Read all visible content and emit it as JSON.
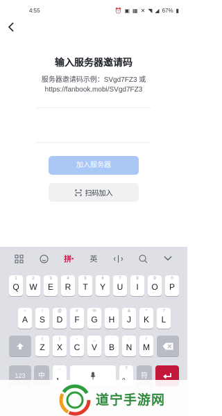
{
  "status": {
    "time": "4:55",
    "battery": "67%"
  },
  "page": {
    "title": "输入服务器邀请码",
    "hint_line1": "服务器邀请码示例：SVgd7FZ3 或",
    "hint_line2": "https://fanbook.mobi/SVgd7FZ3",
    "input_value": "",
    "join_button": "加入服务器",
    "scan_button": "扫码加入"
  },
  "keyboard": {
    "toolbar": [
      "grid-icon",
      "emoji-icon",
      "拼",
      "英",
      "cursor-icon",
      "search-icon",
      "collapse-icon"
    ],
    "row1": [
      {
        "main": "Q",
        "sub": "1"
      },
      {
        "main": "W",
        "sub": "2"
      },
      {
        "main": "E",
        "sub": "3"
      },
      {
        "main": "R",
        "sub": "4"
      },
      {
        "main": "T",
        "sub": "5"
      },
      {
        "main": "Y",
        "sub": "6"
      },
      {
        "main": "U",
        "sub": "7"
      },
      {
        "main": "I",
        "sub": "8"
      },
      {
        "main": "O",
        "sub": "9"
      },
      {
        "main": "P",
        "sub": "0"
      }
    ],
    "row2": [
      {
        "main": "A",
        "sub": "~"
      },
      {
        "main": "S",
        "sub": "!"
      },
      {
        "main": "D",
        "sub": "@"
      },
      {
        "main": "F",
        "sub": "#"
      },
      {
        "main": "G",
        "sub": "%"
      },
      {
        "main": "H",
        "sub": "'"
      },
      {
        "main": "J",
        "sub": "&"
      },
      {
        "main": "K",
        "sub": "*"
      },
      {
        "main": "L",
        "sub": "?"
      }
    ],
    "row3": [
      {
        "main": "Z",
        "sub": "("
      },
      {
        "main": "X",
        "sub": ")"
      },
      {
        "main": "C",
        "sub": "-"
      },
      {
        "main": "V",
        "sub": "_"
      },
      {
        "main": "B",
        "sub": ":"
      },
      {
        "main": "N",
        "sub": ";"
      },
      {
        "main": "M",
        "sub": "/"
      }
    ],
    "bottom": {
      "num": "123",
      "zh": "中",
      "comma": "，",
      "period": "。",
      "sub_comma": ",",
      "sub_period": "?",
      "fu": "符"
    }
  },
  "watermark": {
    "text": "道宁手游网"
  },
  "colors": {
    "accent": "#c2183a",
    "join_button_bg": "#a9c8f5",
    "watermark_green": "#2e8b3d"
  }
}
